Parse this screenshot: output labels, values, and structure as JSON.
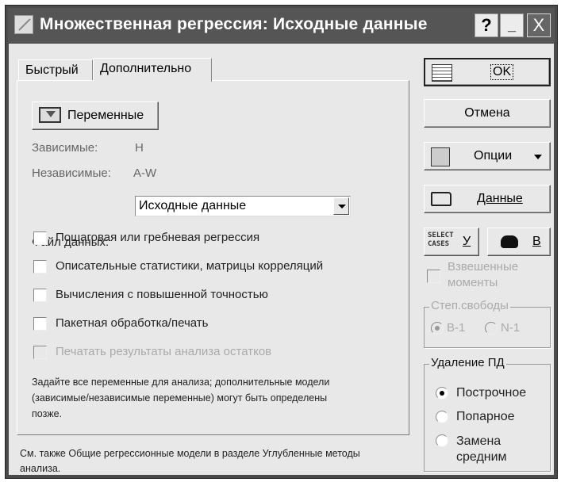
{
  "window": {
    "title": "Множественная регрессия: Исходные данные",
    "help_label": "?",
    "minimize_label": "_",
    "close_label": "X"
  },
  "tabs": [
    {
      "label": "Быстрый",
      "active": false
    },
    {
      "label": "Дополнительно",
      "active": true
    }
  ],
  "panel": {
    "variables_button": "Переменные",
    "dependent_label": "Зависимые:",
    "dependent_value": "H",
    "independent_label": "Независимые:",
    "independent_value": "A-W",
    "datafile_label": "Файл данных:",
    "datafile_value": "Исходные данные",
    "checkboxes": [
      {
        "label": "Пошаговая или гребневая регрессия",
        "checked": false,
        "enabled": true
      },
      {
        "label": "Описательные статистики, матрицы корреляций",
        "checked": false,
        "enabled": true
      },
      {
        "label": "Вычисления с повышенной точностью",
        "checked": false,
        "enabled": true
      },
      {
        "label": "Пакетная обработка/печать",
        "checked": false,
        "enabled": true
      },
      {
        "label": "Печатать результаты анализа остатков",
        "checked": false,
        "enabled": false
      }
    ],
    "hint_line1": "Задайте все переменные для анализа; дополнительные модели",
    "hint_line2": "(зависимые/независимые переменные) могут быть определены",
    "hint_line3": "позже."
  },
  "footer": {
    "line1": "См. также Общие регрессионные модели в разделе Углубленные методы",
    "line2": "анализа."
  },
  "sidebar": {
    "ok_label": "OK",
    "cancel_label": "Отмена",
    "options_label": "Опции",
    "data_label": "Данные",
    "select_cases_icon_text_1": "SELECT",
    "select_cases_icon_text_2": "CASES",
    "select_cases_key": "У",
    "weights_key": "В",
    "weighted_moments_line1": "Взвешенные",
    "weighted_moments_line2": "моменты",
    "dof_title": "Степ.свободы",
    "dof_options": [
      {
        "label": "В-1",
        "selected": true
      },
      {
        "label": "N-1",
        "selected": false
      }
    ],
    "md_title": "Удаление ПД",
    "md_options": [
      {
        "label": "Построчное",
        "selected": true
      },
      {
        "label": "Попарное",
        "selected": false
      },
      {
        "label": "Замена",
        "selected": false
      }
    ],
    "md_option3_line2": "средним"
  }
}
